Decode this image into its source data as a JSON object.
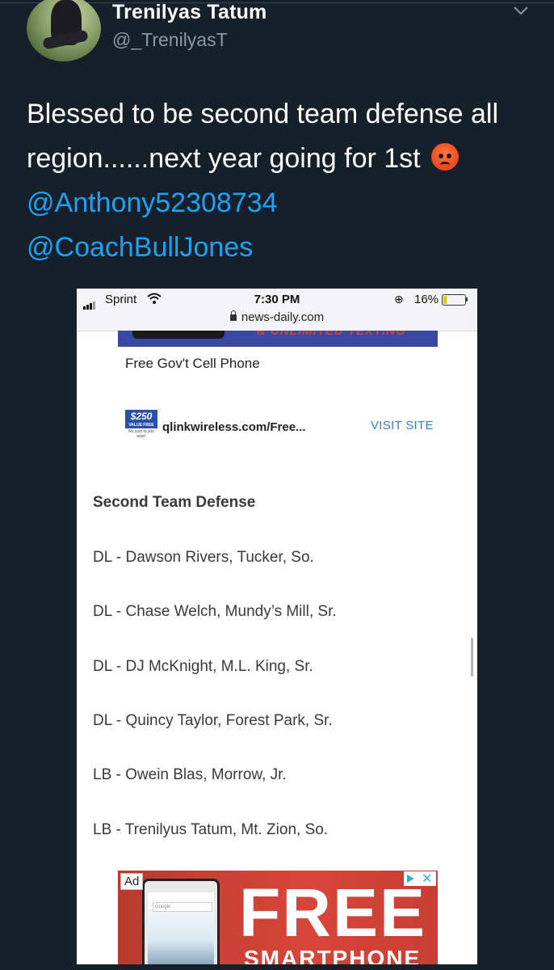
{
  "tweet": {
    "display_name": "Trenilyas Tatum",
    "handle": "@_TrenilyasT",
    "text_line1": "Blessed to be second team defense all",
    "text_line2": "region......next year going for 1st",
    "emoji": "pouting-face",
    "mention_1": "@Anthony52308734",
    "mention_2": "@CoachBullJones"
  },
  "phone": {
    "carrier": "Sprint",
    "time": "7:30 PM",
    "battery": "16%",
    "url": "news-daily.com",
    "ad_banner_text": "& UNLIMITED TEXTING",
    "ad_title": "Free Gov't Cell Phone",
    "ad_badge_amount": "$250",
    "ad_badge_value": "VALUE FREE",
    "ad_badge_note": "No cost to you ever!",
    "ad_link": "qlinkwireless.com/Free...",
    "ad_cta": "VISIT SITE",
    "section_title": "Second Team Defense",
    "roster": [
      "DL - Dawson Rivers, Tucker, So.",
      "DL - Chase Welch, Mundy’s Mill, Sr.",
      "DL - DJ McKnight, M.L. King, Sr.",
      "DL - Quincy Taylor, Forest Park, Sr.",
      "LB - Owein Blas, Morrow, Jr.",
      "LB - Trenilyus Tatum, Mt. Zion, So."
    ],
    "bottom_ad": {
      "label": "Ad",
      "search_text": "Google",
      "headline": "FREE",
      "subline": "SMARTPHONE"
    }
  },
  "colors": {
    "background": "#15202b",
    "mention": "#1da1f2",
    "handle": "#8899a6"
  }
}
